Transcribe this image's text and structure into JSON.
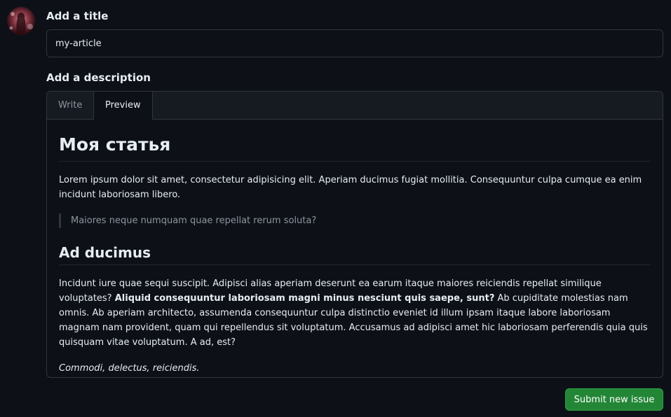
{
  "title_section": {
    "label": "Add a title",
    "value": "my-article"
  },
  "description_section": {
    "label": "Add a description",
    "tabs": [
      {
        "label": "Write",
        "active": false
      },
      {
        "label": "Preview",
        "active": true
      }
    ]
  },
  "preview": {
    "h1": "Моя статья",
    "p1": "Lorem ipsum dolor sit amet, consectetur adipisicing elit. Aperiam ducimus fugiat mollitia. Consequuntur culpa cumque ea enim incidunt laboriosam libero.",
    "blockquote": "Maiores neque numquam quae repellat rerum soluta?",
    "h2": "Ad ducimus",
    "p2_before": "Incidunt iure quae sequi suscipit. Adipisci alias aperiam deserunt ea earum itaque maiores reiciendis repellat similique voluptates? ",
    "p2_bold": "Aliquid consequuntur laboriosam magni minus nesciunt quis saepe, sunt?",
    "p2_after": " Ab cupiditate molestias nam omnis. Ab aperiam architecto, assumenda consequuntur culpa distinctio eveniet id illum ipsam itaque labore laboriosam magnam nam provident, quam qui repellendus sit voluptatum. Accusamus ad adipisci amet hic laboriosam perferendis quia quis quisquam vitae voluptatum. A ad, est?",
    "p3_italic": "Commodi, delectus, reiciendis."
  },
  "submit": {
    "label": "Submit new issue"
  },
  "colors": {
    "background": "#0d1117",
    "border": "#30363d",
    "submit_green": "#238636",
    "muted_text": "#8b949e"
  }
}
